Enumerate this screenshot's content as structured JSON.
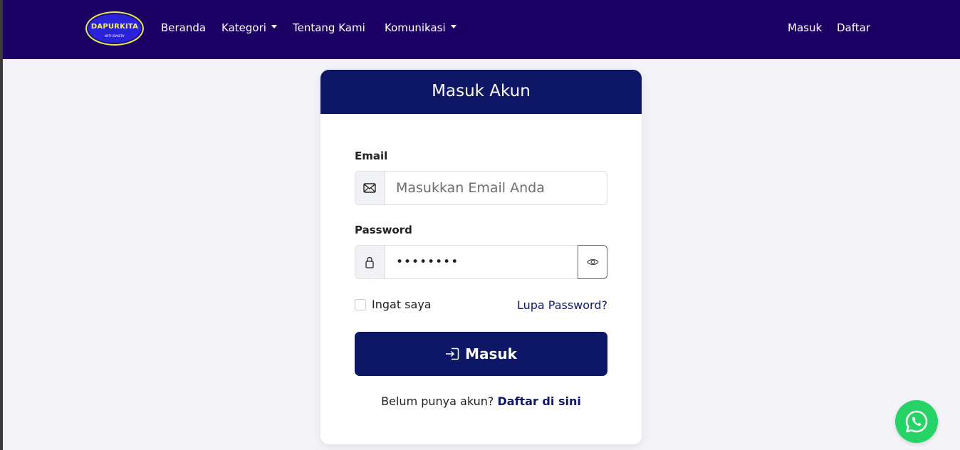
{
  "navbar": {
    "logo": {
      "text": "DAPURKITA",
      "subtext": "WITH BAKERY"
    },
    "links": {
      "home": "Beranda",
      "categories": "Kategori",
      "about": "Tentang Kami",
      "communication": "Komunikasi"
    },
    "auth": {
      "login": "Masuk",
      "register": "Daftar"
    }
  },
  "login_card": {
    "title": "Masuk Akun",
    "email": {
      "label": "Email",
      "placeholder": "Masukkan Email Anda",
      "icon": "envelope-icon"
    },
    "password": {
      "label": "Password",
      "value": "••••••••",
      "icon": "lock-icon",
      "toggle_icon": "eye-icon"
    },
    "remember_label": "Ingat saya",
    "forgot_link": "Lupa Password?",
    "submit_label": "Masuk",
    "submit_icon": "login-arrow-icon",
    "register_prompt": "Belum punya akun?",
    "register_link": "Daftar di sini"
  },
  "floating": {
    "icon": "whatsapp-icon"
  },
  "colors": {
    "navbar_bg": "#1d0064",
    "card_header_bg": "#0e1766",
    "button_bg": "#0e1766",
    "page_bg": "#f4f4f8",
    "whatsapp": "#25d366"
  }
}
